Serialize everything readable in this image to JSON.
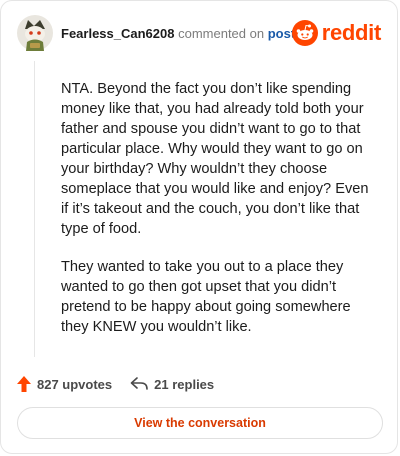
{
  "comment": {
    "username": "Fearless_Can6208",
    "action_text": " commented on ",
    "post_link": "post",
    "paragraphs": [
      "NTA. Beyond the fact you don’t like spending money like that, you had already told both your father and spouse you didn’t want to go to that particular place. Why would they want to go on your birthday? Why wouldn’t they choose someplace that you would like and enjoy? Even if it’s takeout and the couch, you don’t like that type of food.",
      "They wanted to take you out to a place they wanted to go then got upset that you didn’t pretend to be happy about going somewhere they KNEW you wouldn’t like."
    ]
  },
  "brand": {
    "wordmark": "reddit",
    "color": "#ff4500"
  },
  "stats": {
    "upvotes": "827 upvotes",
    "replies": "21 replies"
  },
  "cta": {
    "label": "View the conversation"
  },
  "icons": {
    "avatar": "snoo-avatar",
    "logo": "reddit-logo-icon",
    "upvote": "upvote-arrow-icon",
    "reply": "reply-arrow-icon"
  }
}
